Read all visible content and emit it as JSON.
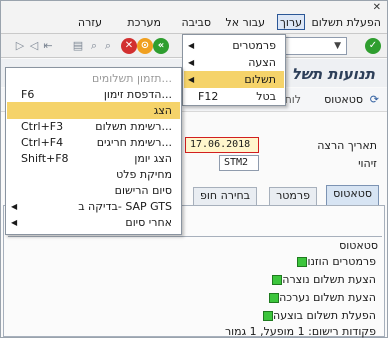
{
  "menubar": {
    "items": [
      {
        "label": "הפעלת תשלום",
        "active": false
      },
      {
        "label": "ערוך",
        "active": true
      },
      {
        "label": "עבור אל",
        "active": false
      },
      {
        "label": "סביבה",
        "active": false
      },
      {
        "label": "מערכת",
        "active": false
      },
      {
        "label": "עזרה",
        "active": false
      }
    ]
  },
  "window": {
    "close_glyph": "✕"
  },
  "toolbar": {
    "command_field_value": "",
    "icons": [
      "check-icon",
      "back-icon",
      "exit-icon",
      "cancel-icon",
      "find-icon",
      "find-next-icon",
      "first-page-icon",
      "prev-page-icon",
      "next-page-icon",
      "last-page-icon"
    ]
  },
  "title": {
    "text": "תנועות תשל"
  },
  "app_toolbar": {
    "status_label": "סטאטוס",
    "next_label": "לוח"
  },
  "form": {
    "run_date_label": "תאריך הרצה",
    "run_date_value": "17.06.2018",
    "id_label": "זיהוי",
    "id_value": "STM2"
  },
  "tabs": [
    {
      "label": "סטאטוס",
      "active": true
    },
    {
      "label": "פרמטר",
      "active": false
    },
    {
      "label": "בחירה חופ",
      "active": false
    }
  ],
  "status": {
    "title": "סטאטוס",
    "rows": [
      {
        "label": "פרמטרים הוזנו",
        "color": "#3cc53c"
      },
      {
        "label": "הצעת תשלום נוצרה",
        "color": "#3cc53c"
      },
      {
        "label": "הצעת תשלום נערכה",
        "color": "#3cc53c"
      },
      {
        "label": "הפעלת תשלום בוצעה",
        "color": "#3cc53c"
      }
    ],
    "postings_text": "פקודות רישום: 1 מופעל, 1 גמור"
  },
  "edit_menu": {
    "items": [
      {
        "label": "פרמטרים",
        "submenu": true,
        "highlighted": false
      },
      {
        "label": "הצעה",
        "submenu": true,
        "highlighted": false
      },
      {
        "label": "תשלום",
        "submenu": true,
        "highlighted": true
      },
      {
        "label": "בטל",
        "shortcut": "F12",
        "submenu": false,
        "highlighted": false
      }
    ]
  },
  "payment_submenu": {
    "items": [
      {
        "label": "תזמון תשלומים...",
        "shortcut": "",
        "submenu": false,
        "disabled": true,
        "highlighted": false
      },
      {
        "label": "הדפסת זימון...",
        "shortcut": "F6",
        "submenu": false,
        "disabled": false,
        "highlighted": false
      },
      {
        "label": "הצג",
        "shortcut": "",
        "submenu": false,
        "disabled": false,
        "highlighted": true
      },
      {
        "label": "רשימת תשלום...",
        "shortcut": "Ctrl+F3",
        "submenu": false,
        "disabled": false,
        "highlighted": false
      },
      {
        "label": "רשימת חריגים...",
        "shortcut": "Ctrl+F4",
        "submenu": false,
        "disabled": false,
        "highlighted": false
      },
      {
        "label": "הצג יומן",
        "shortcut": "Shift+F8",
        "submenu": false,
        "disabled": false,
        "highlighted": false
      },
      {
        "label": "מחיקת פלט",
        "shortcut": "",
        "submenu": false,
        "disabled": false,
        "highlighted": false
      },
      {
        "label": "סיום הרישום",
        "shortcut": "",
        "submenu": false,
        "disabled": false,
        "highlighted": false
      },
      {
        "label": "בדיקה ב- SAP GTS",
        "shortcut": "",
        "submenu": true,
        "disabled": false,
        "highlighted": false
      },
      {
        "label": "אחרי סיום",
        "shortcut": "",
        "submenu": true,
        "disabled": false,
        "highlighted": false
      }
    ]
  }
}
